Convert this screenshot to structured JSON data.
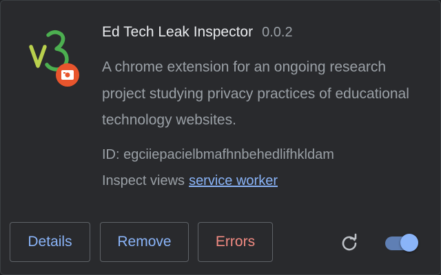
{
  "extension": {
    "logo_icon": "v3-extension-icon",
    "logo_text": "v3",
    "name": "Ed Tech Leak Inspector",
    "version": "0.0.2",
    "description": "A chrome extension for an ongoing research project studying privacy practices of educational technology websites.",
    "id_label": "ID:",
    "id_value": "egciiepacielbmafhnbehedlifhkldam",
    "inspect_label": "Inspect views",
    "inspect_link": "service worker"
  },
  "actions": {
    "details_label": "Details",
    "remove_label": "Remove",
    "errors_label": "Errors",
    "reload_icon": "reload-icon",
    "enabled": true
  },
  "colors": {
    "background": "#292a2d",
    "text_primary": "#e8eaed",
    "text_secondary": "#9aa0a6",
    "link": "#8ab4f8",
    "error": "#f28b82",
    "badge": "#e8552d"
  }
}
